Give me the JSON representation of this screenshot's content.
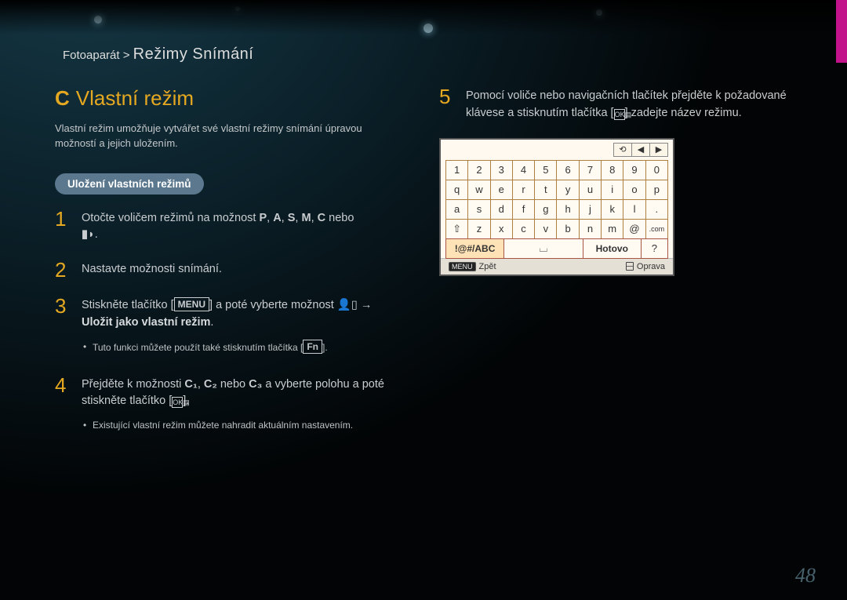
{
  "breadcrumb": {
    "prefix": "Fotoaparát >",
    "title": "Režimy Snímání"
  },
  "heading": {
    "glyph": "C",
    "text": "Vlastní režim"
  },
  "intro": "Vlastní režim umožňuje vytvářet své vlastní režimy snímání úpravou možností a jejich uložením.",
  "pill": "Uložení vlastních režimů",
  "steps": {
    "s1a": "Otočte voličem režimů na možnost ",
    "s1_modes": [
      "P",
      "A",
      "S",
      "M",
      "C"
    ],
    "s1_sep": ", ",
    "s1b": " nebo ",
    "s1_vid": "▮◗",
    "s1end": ".",
    "s2": "Nastavte možnosti snímání.",
    "s3a": "Stiskněte tlačítko [",
    "s3_menu": "MENU",
    "s3b": "] a poté vyberte možnost ",
    "s3_user": "👤▯",
    "s3arrow": " → ",
    "s3bold": "Uložit jako vlastní režim",
    "s3end": ".",
    "s3_sub": "Tuto funkci můžete použít také stisknutím tlačítka [",
    "s3_fn": "Fn",
    "s3_sub_end": "].",
    "s4a": "Přejděte k možnosti ",
    "s4_c": [
      "C₁",
      "C₂"
    ],
    "s4_or": " nebo ",
    "s4_c3": "C₃",
    "s4b": " a vyberte polohu a poté stiskněte tlačítko [",
    "s4_ok": "OK▤",
    "s4end": "].",
    "s4_sub": "Existující vlastní režim můžete nahradit aktuálním nastavením.",
    "s5a": "Pomocí voliče nebo navigačních tlačítek přejděte k požadované klávese a stisknutím tlačítka [",
    "s5_ok": "OK▤",
    "s5b": "] zadejte název režimu."
  },
  "keyboard": {
    "top": [
      "⟲",
      "◀",
      "▶"
    ],
    "r1": [
      "1",
      "2",
      "3",
      "4",
      "5",
      "6",
      "7",
      "8",
      "9",
      "0"
    ],
    "r2": [
      "q",
      "w",
      "e",
      "r",
      "t",
      "y",
      "u",
      "i",
      "o",
      "p"
    ],
    "r3": [
      "a",
      "s",
      "d",
      "f",
      "g",
      "h",
      "j",
      "k",
      "l",
      "."
    ],
    "r4": [
      "⇧",
      "z",
      "x",
      "c",
      "v",
      "b",
      "n",
      "m",
      "@",
      ".com"
    ],
    "fn_label": "!@#/ABC",
    "fn_space": "⌴",
    "fn_done": "Hotovo",
    "fn_q": "?",
    "foot_back_btn": "MENU",
    "foot_back": "Zpět",
    "foot_del": "Oprava"
  },
  "pagenum": "48"
}
